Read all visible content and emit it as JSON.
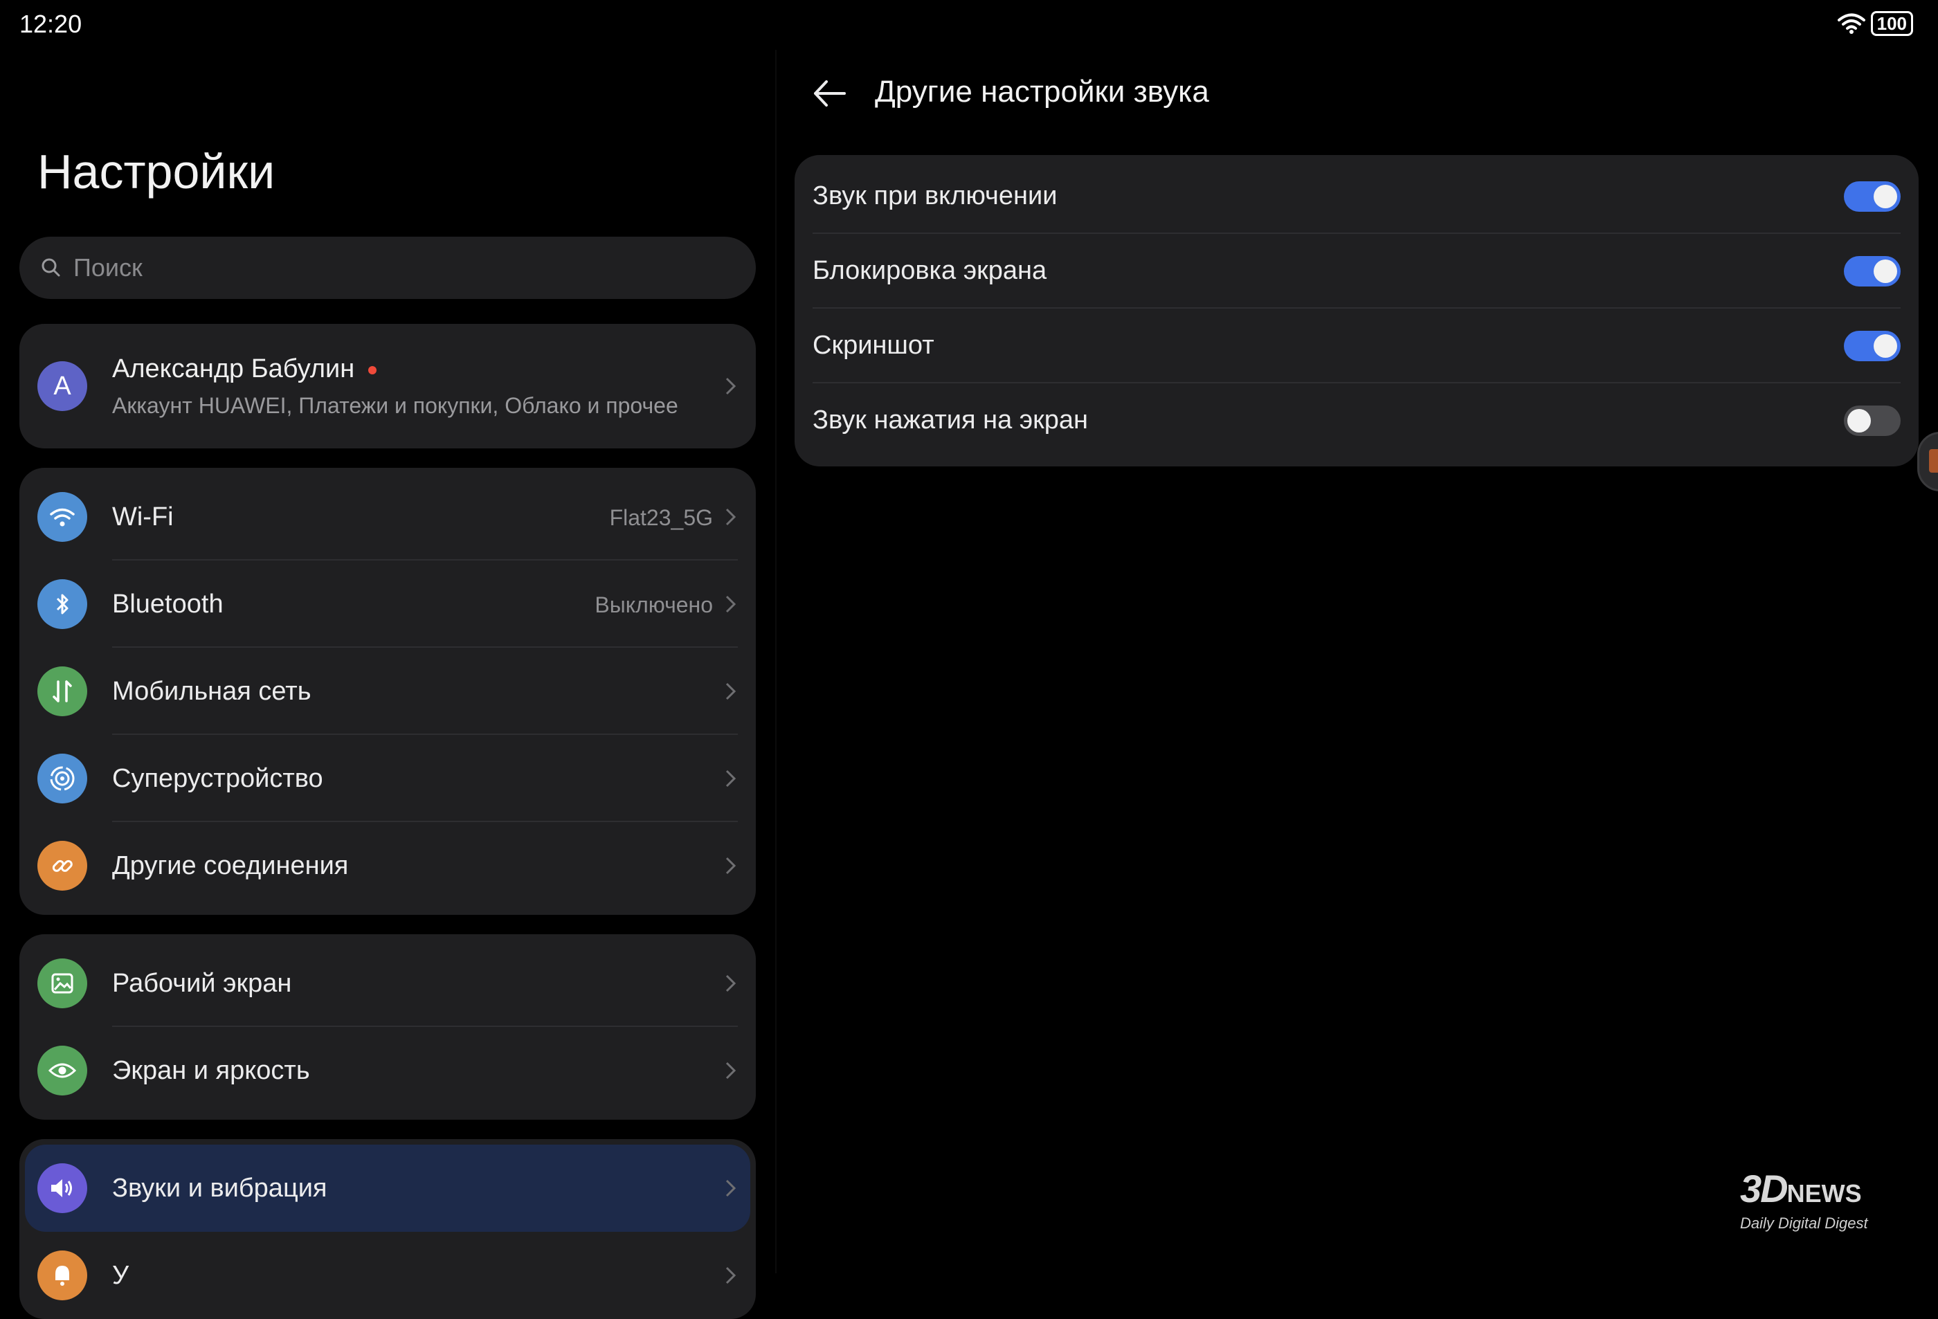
{
  "status": {
    "time": "12:20",
    "battery": "100",
    "icons": [
      "wifi-icon",
      "battery-icon"
    ]
  },
  "left": {
    "title": "Настройки",
    "search_placeholder": "Поиск",
    "account": {
      "avatar": "A",
      "name": "Александр Бабулин",
      "subtitle": "Аккаунт HUAWEI, Платежи и покупки, Облако и прочее"
    },
    "connectivity": [
      {
        "label": "Wi-Fi",
        "value": "Flat23_5G",
        "icon": "wifi-icon",
        "color": "#4f8fd3"
      },
      {
        "label": "Bluetooth",
        "value": "Выключено",
        "icon": "bluetooth-icon",
        "color": "#4f8fd3"
      },
      {
        "label": "Мобильная сеть",
        "value": "",
        "icon": "mobile-network-icon",
        "color": "#55a35b"
      },
      {
        "label": "Суперустройство",
        "value": "",
        "icon": "super-device-icon",
        "color": "#4f8fd3"
      },
      {
        "label": "Другие соединения",
        "value": "",
        "icon": "link-icon",
        "color": "#e08a3c"
      }
    ],
    "display": [
      {
        "label": "Рабочий экран",
        "icon": "home-screen-icon",
        "color": "#55a35b"
      },
      {
        "label": "Экран и яркость",
        "icon": "eye-icon",
        "color": "#55a35b"
      }
    ],
    "sound": [
      {
        "label": "Звуки и вибрация",
        "icon": "speaker-icon",
        "color": "#6a5bd6"
      },
      {
        "label": "У",
        "icon": "notification-icon",
        "color": "#e08a3c"
      }
    ]
  },
  "right": {
    "title": "Другие настройки звука",
    "toggles": [
      {
        "label": "Звук при включении",
        "on": true
      },
      {
        "label": "Блокировка экрана",
        "on": true
      },
      {
        "label": "Скриншот",
        "on": true
      },
      {
        "label": "Звук нажатия на экран",
        "on": false
      }
    ]
  },
  "watermark": {
    "logo": "3D",
    "news": "NEWS",
    "tagline": "Daily Digital Digest"
  },
  "colors": {
    "accent": "#3f72e9",
    "card": "#1f1f21",
    "background": "#000000"
  }
}
